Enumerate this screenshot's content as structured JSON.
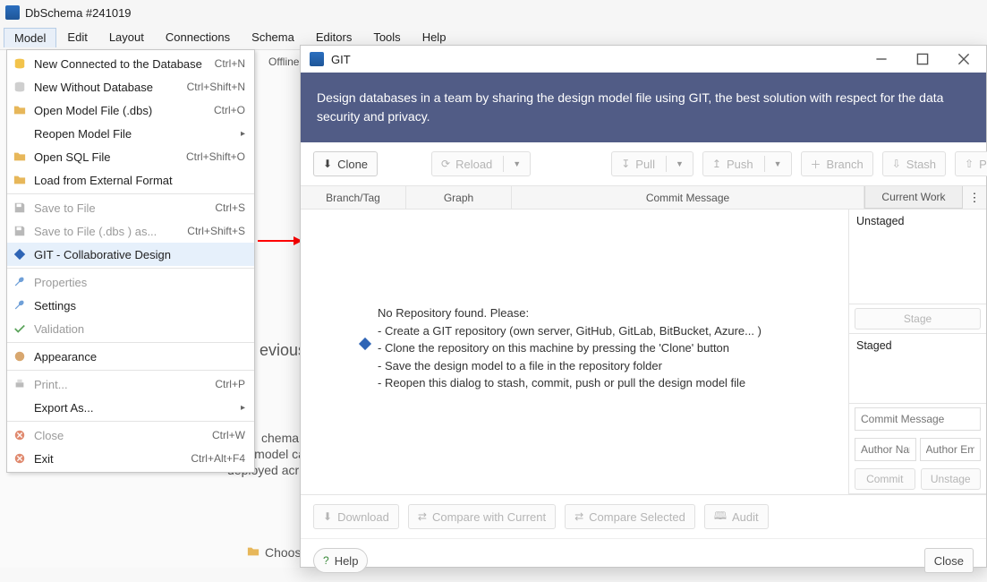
{
  "app": {
    "title": "DbSchema #241019"
  },
  "menubar": [
    "Model",
    "Edit",
    "Layout",
    "Connections",
    "Schema",
    "Editors",
    "Tools",
    "Help"
  ],
  "model_menu": [
    {
      "icon": "db-yellow",
      "label": "New Connected to the Database",
      "shortcut": "Ctrl+N"
    },
    {
      "icon": "db-grey",
      "label": "New Without Database",
      "shortcut": "Ctrl+Shift+N"
    },
    {
      "icon": "folder",
      "label": "Open Model File (.dbs)",
      "shortcut": "Ctrl+O"
    },
    {
      "icon": "",
      "label": "Reopen Model File",
      "submenu": true
    },
    {
      "icon": "folder",
      "label": "Open SQL File",
      "shortcut": "Ctrl+Shift+O"
    },
    {
      "icon": "folder",
      "label": "Load from External Format"
    },
    {
      "sep": true
    },
    {
      "icon": "save",
      "label": "Save to File",
      "shortcut": "Ctrl+S",
      "disabled": true
    },
    {
      "icon": "save",
      "label": "Save to File (.dbs ) as...",
      "shortcut": "Ctrl+Shift+S",
      "disabled": true
    },
    {
      "icon": "git",
      "label": "GIT - Collaborative Design",
      "highlight": true
    },
    {
      "sep": true
    },
    {
      "icon": "wrench",
      "label": "Properties",
      "disabled": true
    },
    {
      "icon": "wrench",
      "label": "Settings"
    },
    {
      "icon": "check",
      "label": "Validation",
      "disabled": true
    },
    {
      "sep": true
    },
    {
      "icon": "palette",
      "label": "Appearance"
    },
    {
      "sep": true
    },
    {
      "icon": "print",
      "label": "Print...",
      "shortcut": "Ctrl+P",
      "disabled": true
    },
    {
      "icon": "",
      "label": "Export As...",
      "submenu": true
    },
    {
      "sep": true
    },
    {
      "icon": "close-r",
      "label": "Close",
      "shortcut": "Ctrl+W",
      "disabled": true
    },
    {
      "icon": "close-r",
      "label": "Exit",
      "shortcut": "Ctrl+Alt+F4"
    }
  ],
  "bg": {
    "offline": "Offline",
    "evious": "evious",
    "chema": "chema,",
    "line2": "The design model ca",
    "line3": "deployed acr",
    "choos": "Choos"
  },
  "git": {
    "title": "GIT",
    "banner": "Design databases in a team by sharing the design model file using GIT, the best solution with respect for the data security and privacy.",
    "toolbar": {
      "clone": "Clone",
      "reload": "Reload",
      "pull": "Pull",
      "push": "Push",
      "branch": "Branch",
      "stash": "Stash",
      "pop": "Pop"
    },
    "headers": {
      "branch": "Branch/Tag",
      "graph": "Graph",
      "commit": "Commit Message",
      "current": "Current Work"
    },
    "empty": {
      "l1": "No Repository found. Please:",
      "l2": "- Create a GIT repository (own server, GitHub, GitLab, BitBucket, Azure... )",
      "l3": "- Clone the repository on this machine by pressing the 'Clone' button",
      "l4": "- Save the design model to a file in the repository folder",
      "l5": "- Reopen this dialog to stash, commit, push or pull the design model file"
    },
    "side": {
      "unstaged": "Unstaged",
      "stage_btn": "Stage",
      "staged": "Staged",
      "commit_ph": "Commit Message",
      "author_name_ph": "Author Name",
      "author_email_ph": "Author Email",
      "commit_btn": "Commit",
      "unstage_btn": "Unstage"
    },
    "bottom": {
      "download": "Download",
      "compare_current": "Compare with Current",
      "compare_sel": "Compare Selected",
      "audit": "Audit"
    },
    "footer": {
      "help": "Help",
      "close": "Close"
    }
  }
}
